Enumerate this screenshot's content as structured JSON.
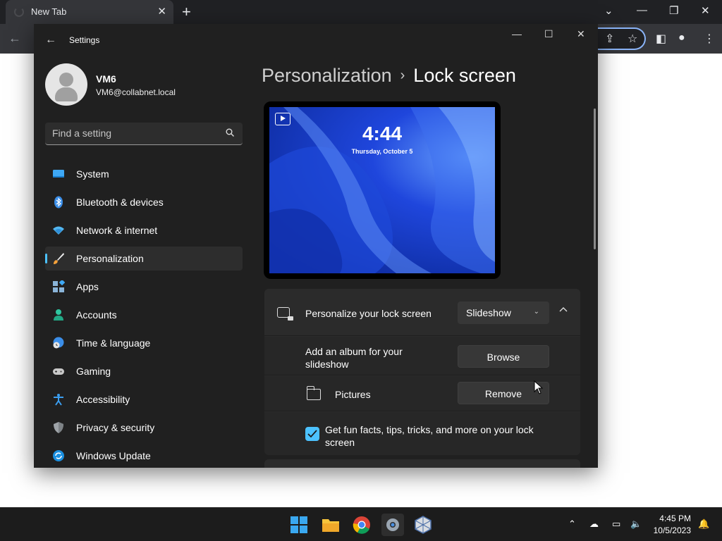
{
  "browser": {
    "tab_title": "New Tab",
    "new_tab": "+"
  },
  "settings": {
    "window_title": "Settings",
    "user": {
      "name": "VM6",
      "email": "VM6@collabnet.local"
    },
    "search_placeholder": "Find a setting",
    "nav": [
      {
        "label": "System",
        "icon": "system-icon"
      },
      {
        "label": "Bluetooth & devices",
        "icon": "bluetooth-icon"
      },
      {
        "label": "Network & internet",
        "icon": "wifi-icon"
      },
      {
        "label": "Personalization",
        "icon": "brush-icon",
        "active": true
      },
      {
        "label": "Apps",
        "icon": "apps-icon"
      },
      {
        "label": "Accounts",
        "icon": "accounts-icon"
      },
      {
        "label": "Time & language",
        "icon": "globe-clock-icon"
      },
      {
        "label": "Gaming",
        "icon": "gamepad-icon"
      },
      {
        "label": "Accessibility",
        "icon": "accessibility-icon"
      },
      {
        "label": "Privacy & security",
        "icon": "shield-icon"
      },
      {
        "label": "Windows Update",
        "icon": "update-icon"
      }
    ],
    "breadcrumb": {
      "parent": "Personalization",
      "separator": "›",
      "current": "Lock screen"
    },
    "preview": {
      "time": "4:44",
      "date": "Thursday, October 5"
    },
    "lock_card": {
      "label": "Personalize your lock screen",
      "dropdown_value": "Slideshow",
      "album_label": "Add an album for your slideshow",
      "browse_label": "Browse",
      "folder_label": "Pictures",
      "remove_label": "Remove",
      "tips_label": "Get fun facts, tips, tricks, and more on your lock screen",
      "tips_checked": true
    }
  },
  "taskbar": {
    "time": "4:45 PM",
    "date": "10/5/2023",
    "apps": [
      "start-icon",
      "file-explorer-icon",
      "chrome-icon",
      "settings-icon",
      "virtualbox-icon"
    ]
  },
  "colors": {
    "accent": "#4cc2ff",
    "window_bg": "#202020",
    "card_bg": "#2b2b2b"
  }
}
